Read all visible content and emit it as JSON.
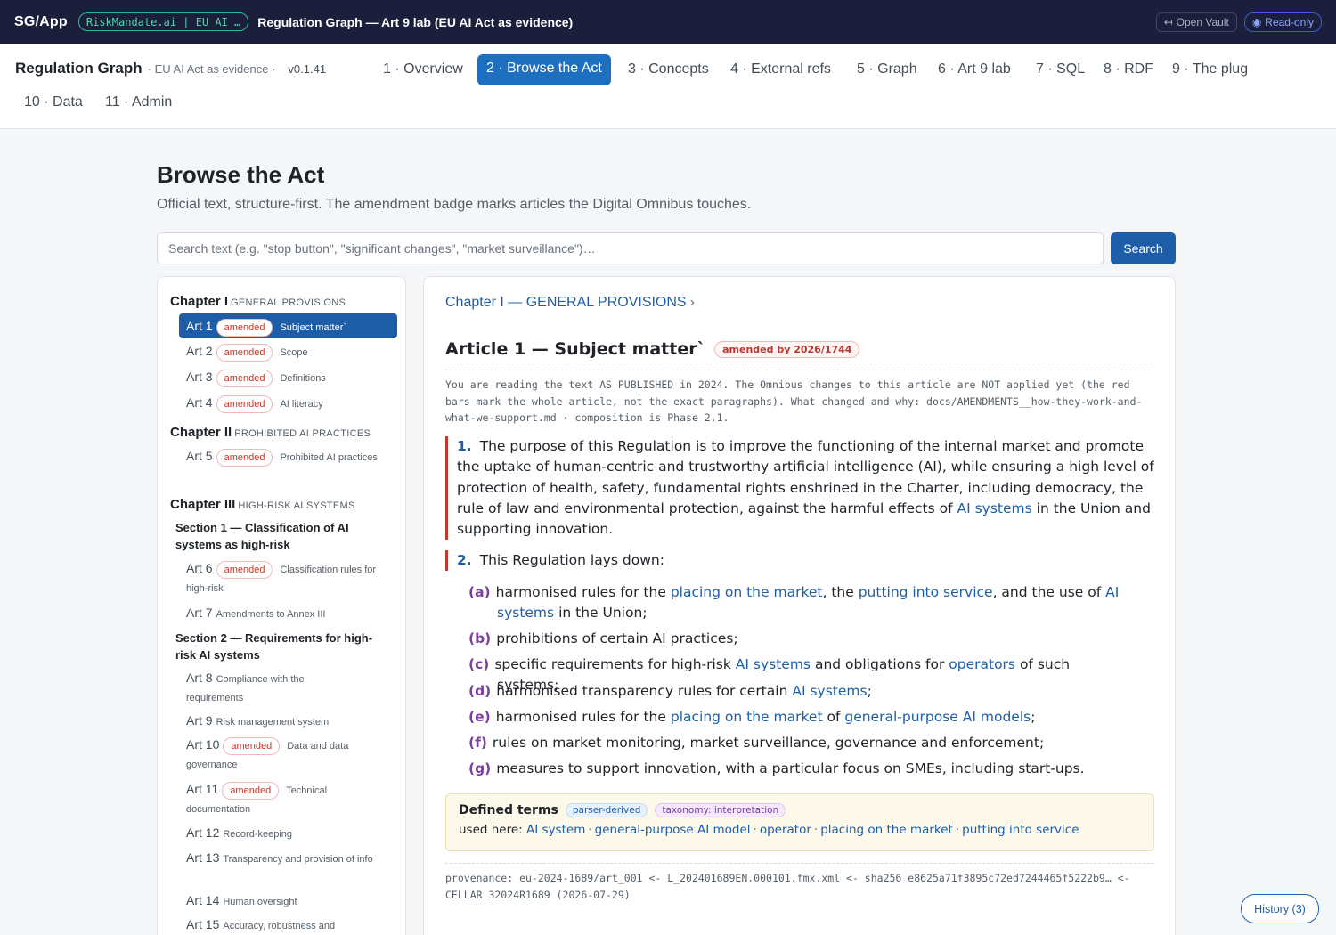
{
  "appbar": {
    "brand": "SG/App",
    "pill": "RiskMandate.ai | EU AI …",
    "title": "Regulation Graph — Art 9 lab (EU AI Act as evidence)",
    "open_vault": "Open Vault",
    "read_only": "Read-only"
  },
  "nav": {
    "title": "Regulation Graph",
    "subtitle": "· EU AI Act as evidence ·",
    "version": "v0.1.41",
    "tabs": [
      {
        "label": "1 · Overview"
      },
      {
        "label": "2 · Browse the Act"
      },
      {
        "label": "3 · Concepts"
      },
      {
        "label": "4 · External refs"
      },
      {
        "label": "5 · Graph"
      },
      {
        "label": "6 · Art 9 lab"
      },
      {
        "label": "7 · SQL"
      },
      {
        "label": "8 · RDF"
      },
      {
        "label": "9 · The plug"
      },
      {
        "label": "10 · Data"
      },
      {
        "label": "11 · Admin"
      }
    ]
  },
  "page": {
    "title": "Browse the Act",
    "subtitle": "Official text, structure-first. The amendment badge marks articles the Digital Omnibus touches.",
    "search_placeholder": "Search text (e.g. \"stop button\", \"significant changes\", \"market surveillance\")…",
    "search_button": "Search"
  },
  "sidebar": {
    "amended_label": "amended",
    "chapters": [
      {
        "num": "Chapter I",
        "cap": "GENERAL PROVISIONS"
      },
      {
        "num": "Chapter II",
        "cap": "PROHIBITED AI PRACTICES"
      },
      {
        "num": "Chapter III",
        "cap": "HIGH-RISK AI SYSTEMS"
      }
    ],
    "sections": [
      "Section 1 — Classification of AI systems as high-risk",
      "Section 2 — Requirements for high-risk AI systems"
    ],
    "articles": [
      {
        "num": "Art 1",
        "label": "Subject matter`"
      },
      {
        "num": "Art 2",
        "label": "Scope"
      },
      {
        "num": "Art 3",
        "label": "Definitions"
      },
      {
        "num": "Art 4",
        "label": "AI literacy"
      },
      {
        "num": "Art 5",
        "label": "Prohibited AI practices"
      },
      {
        "num": "Art 6",
        "label": "Classification rules for high-risk"
      },
      {
        "num": "Art 7",
        "label": "Amendments to Annex III"
      },
      {
        "num": "Art 8",
        "label": "Compliance with the requirements"
      },
      {
        "num": "Art 9",
        "label": "Risk management system"
      },
      {
        "num": "Art 10",
        "label": "Data and data governance"
      },
      {
        "num": "Art 11",
        "label": "Technical documentation"
      },
      {
        "num": "Art 12",
        "label": "Record-keeping"
      },
      {
        "num": "Art 13",
        "label": "Transparency and provision of info"
      },
      {
        "num": "Art 14",
        "label": "Human oversight"
      },
      {
        "num": "Art 15",
        "label": "Accuracy, robustness and"
      }
    ]
  },
  "article": {
    "breadcrumb": "Chapter I — GENERAL PROVISIONS",
    "breadcrumb_chevron": "›",
    "title": "Article 1 — Subject matter`",
    "badge": "amended by 2026/1744",
    "note": "You are reading the text AS PUBLISHED in 2024. The Omnibus changes to this article are NOT applied yet (the red bars mark the whole article, not the exact paragraphs). What changed and why: docs/AMENDMENTS__how-they-work-and-what-we-support.md · composition is Phase 2.1.",
    "p1": {
      "num": "1.",
      "a": "The purpose of this Regulation is to improve the functioning of the internal market and promote the uptake of human-centric and trustworthy artificial intelligence (AI), while ensuring a high level of protection of health, safety, fundamental rights enshrined in the Charter, including democracy, the rule of law and environmental protection, against the harmful effects of",
      "link": "AI systems",
      "b": "in the Union and supporting innovation."
    },
    "p2": {
      "num": "2.",
      "text": "This Regulation lays down:"
    },
    "items": {
      "a": {
        "l": "(a)",
        "t1": "harmonised rules for the",
        "k1": "placing on the market",
        "t2": ", the",
        "k2": "putting into service",
        "t3": ", and the use of",
        "k3": "AI systems",
        "t4": "in the Union;"
      },
      "b": {
        "l": "(b)",
        "t": "prohibitions of certain AI practices;"
      },
      "c": {
        "l": "(c)",
        "t1": "specific requirements for high-risk",
        "k1": "AI systems",
        "t2": "and obligations for",
        "k2": "operators",
        "t3": "of such systems;"
      },
      "d": {
        "l": "(d)",
        "t1": "harmonised transparency rules for certain",
        "k1": "AI systems",
        "t2": ";"
      },
      "e": {
        "l": "(e)",
        "t1": "harmonised rules for the",
        "k1": "placing on the market",
        "t2": "of",
        "k2": "general-purpose AI models",
        "t3": ";"
      },
      "f": {
        "l": "(f)",
        "t": "rules on market monitoring, market surveillance, governance and enforcement;"
      },
      "g": {
        "l": "(g)",
        "t": "measures to support innovation, with a particular focus on SMEs, including start-ups."
      }
    },
    "defined_terms": {
      "title": "Defined terms",
      "chip1": "parser-derived",
      "chip2": "taxonomy: interpretation",
      "used_here": "used here:",
      "sep": "·",
      "terms": [
        "AI system",
        "general-purpose AI model",
        "operator",
        "placing on the market",
        "putting into service"
      ]
    },
    "provenance": "provenance: eu-2024-1689/art_001 <- L_202401689EN.000101.fmx.xml <- sha256 e8625a71f3895c72ed7244465f5222b9… <- CELLAR 32024R1689 (2026-07-29)"
  },
  "history_button": "History (3)",
  "colors": {
    "accent": "#1e5ea8",
    "amended": "#c0392b",
    "appbar": "#1b1f3b"
  }
}
